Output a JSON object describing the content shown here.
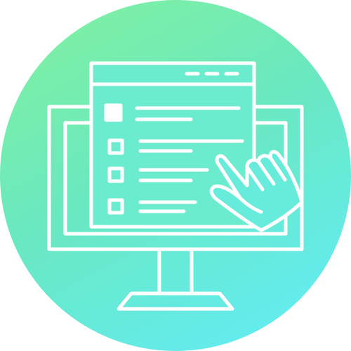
{
  "badge": {
    "gradient_start": "#7ff0a3",
    "gradient_mid": "#6ae8c0",
    "gradient_end": "#63ecf2",
    "line_color": "#ffffff"
  },
  "icons": {
    "main": "computer-monitor-checklist-icon",
    "window": "browser-window-icon",
    "pointer": "pointing-hand-icon"
  },
  "checklist": {
    "item_count": 4,
    "first_item_checked": true
  }
}
